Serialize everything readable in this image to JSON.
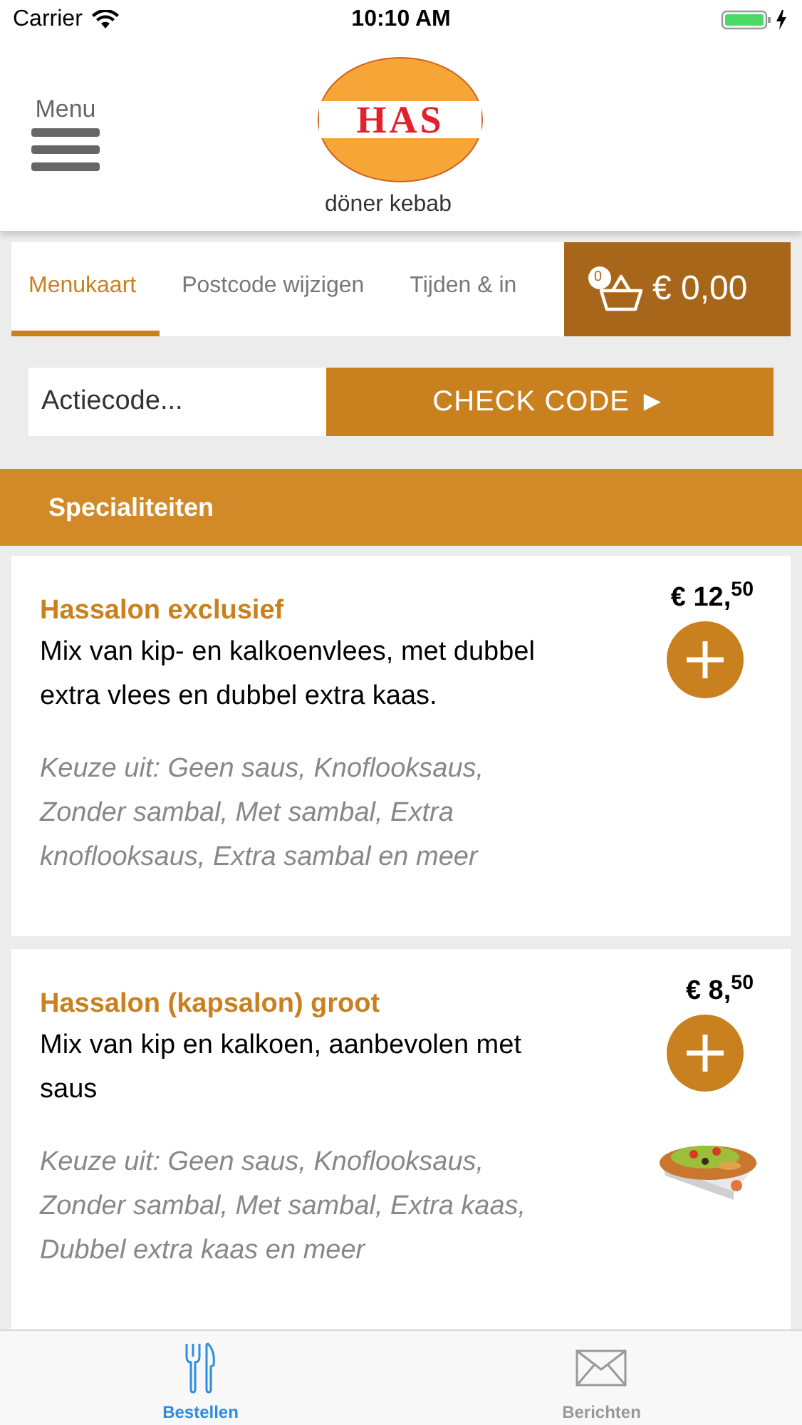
{
  "status_bar": {
    "carrier": "Carrier",
    "time": "10:10 AM"
  },
  "header": {
    "menu_label": "Menu",
    "logo_text": "HAS",
    "logo_subtitle": "döner kebab"
  },
  "tabs": [
    {
      "label": "Menukaart",
      "selected": true
    },
    {
      "label": "Postcode wijzigen",
      "selected": false
    },
    {
      "label": "Tijden & in",
      "selected": false
    }
  ],
  "cart": {
    "count": "0",
    "total": "€ 0,00"
  },
  "promo": {
    "placeholder": "Actiecode...",
    "button": "CHECK CODE ►"
  },
  "section": {
    "title": "Specialiteiten"
  },
  "products": [
    {
      "name": "Hassalon exclusief",
      "description": "Mix van kip- en kalkoenvlees, met dubbel extra vlees en dubbel extra kaas.",
      "options": "Keuze uit: Geen saus, Knoflooksaus, Zonder sambal, Met sambal, Extra knoflooksaus, Extra sambal en meer",
      "price": "€ 12,$^{50}$",
      "has_photo": false
    },
    {
      "name": "Hassalon (kapsalon) groot",
      "description": "Mix van kip en kalkoen, aanbevolen met saus",
      "options": "Keuze uit: Geen saus, Knoflooksaus, Zonder sambal, Met sambal, Extra kaas, Dubbel extra kaas en meer",
      "price": "€ 8,$^{50}$",
      "has_photo": true
    }
  ],
  "bottom_tabs": [
    {
      "label": "Bestellen",
      "kind": "cutlery",
      "selected": true
    },
    {
      "label": "Berichten",
      "kind": "envelope",
      "selected": false
    }
  ]
}
